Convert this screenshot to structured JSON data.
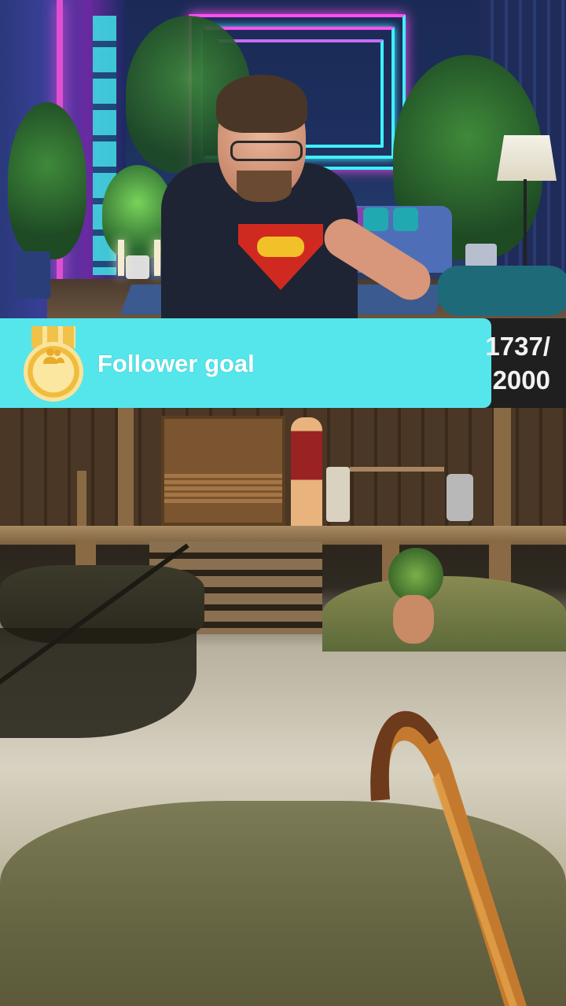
{
  "widget": {
    "title": "Follower goal",
    "current": "1737",
    "target": "2000",
    "count_line1": "1737/",
    "count_line2": "2000",
    "progress_fraction": 0.8685,
    "icon": "followers-medal-icon",
    "fill_color": "#55e6ec",
    "track_color": "#1f1f1f"
  }
}
